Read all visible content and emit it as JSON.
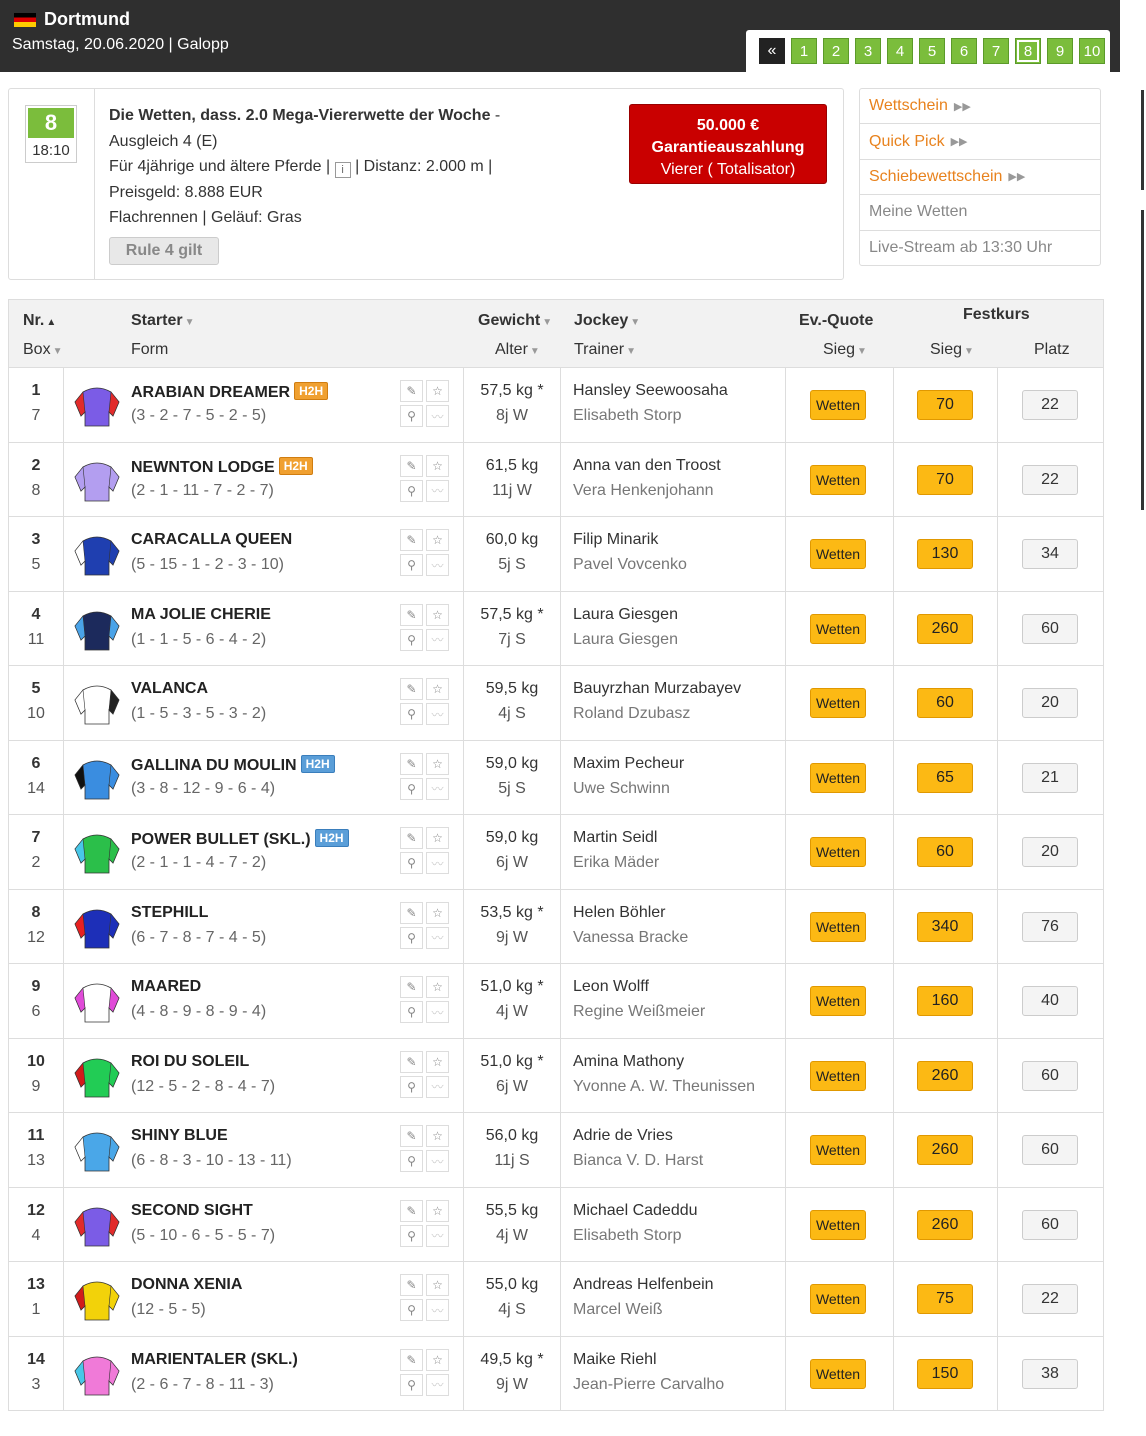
{
  "header": {
    "venue": "Dortmund",
    "subtitle": "Samstag, 20.06.2020  |  Galopp"
  },
  "racenav": {
    "back": "«",
    "races": [
      "1",
      "2",
      "3",
      "4",
      "5",
      "6",
      "7",
      "8",
      "9",
      "10"
    ],
    "active": "8"
  },
  "race": {
    "number": "8",
    "time": "18:10",
    "title": "Die Wetten, dass. 2.0 Mega-Viererwette der Woche",
    "title_suffix": " -",
    "line2": "Ausgleich 4 (E)",
    "line3a": "Für 4jährige und ältere Pferde  |  ",
    "info_icon": "i",
    "line3b": "  |  Distanz: 2.000 m  |",
    "line4": "Preisgeld: 8.888 EUR",
    "line5": "Flachrennen  |  Geläuf: Gras",
    "rule": "Rule 4 gilt",
    "garantie_amount": "50.000 €",
    "garantie_label": "Garantieauszahlung",
    "garantie_sub": "Vierer ( Totalisator)"
  },
  "links": {
    "wettschein": "Wettschein",
    "quickpick": "Quick Pick",
    "schiebe": "Schiebewettschein",
    "meine": "Meine Wetten",
    "live": "Live-Stream ab 13:30 Uhr",
    "arrows": "▶▶"
  },
  "table_head": {
    "nr": "Nr.",
    "box": "Box",
    "starter": "Starter",
    "form": "Form",
    "gewicht": "Gewicht",
    "alter": "Alter",
    "jockey": "Jockey",
    "trainer": "Trainer",
    "evquote": "Ev.-Quote",
    "evsieg": "Sieg",
    "festkurs": "Festkurs",
    "fksieg": "Sieg",
    "fkplatz": "Platz",
    "sort_up": "▲",
    "sort_down": "▼"
  },
  "bet_label": "Wetten",
  "h2h_label": "H2H",
  "colors": {
    "accent": "#e8821d",
    "green": "#7bbd3c",
    "gold": "#fcb914",
    "red": "#c90000"
  },
  "runners": [
    {
      "nr": "1",
      "box": "7",
      "name": "ARABIAN DREAMER",
      "h2h": "orange",
      "form": "(3 - 2 - 7 - 5 - 2 - 5)",
      "gewicht": "57,5 kg *",
      "alter": "8j W",
      "jockey": "Hansley Seewoosaha",
      "trainer": "Elisabeth Storp",
      "sieg": "70",
      "platz": "22",
      "silk": [
        "#7b5ce6",
        "#e22b2b",
        "#e22b2b"
      ]
    },
    {
      "nr": "2",
      "box": "8",
      "name": "NEWNTON LODGE",
      "h2h": "orange",
      "form": "(2 - 1 - 11 - 7 - 2 - 7)",
      "gewicht": "61,5 kg",
      "alter": "11j W",
      "jockey": "Anna van den Troost",
      "trainer": "Vera Henkenjohann",
      "sieg": "70",
      "platz": "22",
      "silk": [
        "#b39ef0",
        "#b39ef0",
        "#b39ef0"
      ]
    },
    {
      "nr": "3",
      "box": "5",
      "name": "CARACALLA QUEEN",
      "h2h": "",
      "form": "(5 - 15 - 1 - 2 - 3 - 10)",
      "gewicht": "60,0 kg",
      "alter": "5j S",
      "jockey": "Filip Minarik",
      "trainer": "Pavel Vovcenko",
      "sieg": "130",
      "platz": "34",
      "silk": [
        "#1f3fb0",
        "#ffffff",
        "#1f3fb0"
      ]
    },
    {
      "nr": "4",
      "box": "11",
      "name": "MA JOLIE CHERIE",
      "h2h": "",
      "form": "(1 - 1 - 5 - 6 - 4 - 2)",
      "gewicht": "57,5 kg *",
      "alter": "7j S",
      "jockey": "Laura Giesgen",
      "trainer": "Laura Giesgen",
      "sieg": "260",
      "platz": "60",
      "silk": [
        "#1c2a5c",
        "#4aa3e8",
        "#4aa3e8"
      ]
    },
    {
      "nr": "5",
      "box": "10",
      "name": "VALANCA",
      "h2h": "",
      "form": "(1 - 5 - 3 - 5 - 3 - 2)",
      "gewicht": "59,5 kg",
      "alter": "4j S",
      "jockey": "Bauyrzhan Murzabayev",
      "trainer": "Roland Dzubasz",
      "sieg": "60",
      "platz": "20",
      "silk": [
        "#ffffff",
        "#ffffff",
        "#222222"
      ]
    },
    {
      "nr": "6",
      "box": "14",
      "name": "GALLINA DU MOULIN",
      "h2h": "blue",
      "form": "(3 - 8 - 12 - 9 - 6 - 4)",
      "gewicht": "59,0 kg",
      "alter": "5j S",
      "jockey": "Maxim Pecheur",
      "trainer": "Uwe Schwinn",
      "sieg": "65",
      "platz": "21",
      "silk": [
        "#3a8de0",
        "#111111",
        "#3a8de0"
      ]
    },
    {
      "nr": "7",
      "box": "2",
      "name": "POWER BULLET (SKL.)",
      "h2h": "blue",
      "form": "(2 - 1 - 1 - 4 - 7 - 2)",
      "gewicht": "59,0 kg",
      "alter": "6j W",
      "jockey": "Martin Seidl",
      "trainer": "Erika Mäder",
      "sieg": "60",
      "platz": "20",
      "silk": [
        "#2bbf4a",
        "#48c7e8",
        "#2bbf4a"
      ]
    },
    {
      "nr": "8",
      "box": "12",
      "name": "STEPHILL",
      "h2h": "",
      "form": "(6 - 7 - 8 - 7 - 4 - 5)",
      "gewicht": "53,5 kg *",
      "alter": "9j W",
      "jockey": "Helen Böhler",
      "trainer": "Vanessa Bracke",
      "sieg": "340",
      "platz": "76",
      "silk": [
        "#1d2fb8",
        "#e82020",
        "#1d2fb8"
      ]
    },
    {
      "nr": "9",
      "box": "6",
      "name": "MAARED",
      "h2h": "",
      "form": "(4 - 8 - 9 - 8 - 9 - 4)",
      "gewicht": "51,0 kg *",
      "alter": "4j W",
      "jockey": "Leon Wolff",
      "trainer": "Regine Weißmeier",
      "sieg": "160",
      "platz": "40",
      "silk": [
        "#ffffff",
        "#e04ad8",
        "#e04ad8"
      ]
    },
    {
      "nr": "10",
      "box": "9",
      "name": "ROI DU SOLEIL",
      "h2h": "",
      "form": "(12 - 5 - 2 - 8 - 4 - 7)",
      "gewicht": "51,0 kg *",
      "alter": "6j W",
      "jockey": "Amina Mathony",
      "trainer": "Yvonne A. W. Theunissen",
      "sieg": "260",
      "platz": "60",
      "silk": [
        "#22cc55",
        "#d21b1b",
        "#22cc55"
      ]
    },
    {
      "nr": "11",
      "box": "13",
      "name": "SHINY BLUE",
      "h2h": "",
      "form": "(6 - 8 - 3 - 10 - 13 - 11)",
      "gewicht": "56,0 kg",
      "alter": "11j S",
      "jockey": "Adrie de Vries",
      "trainer": "Bianca V. D. Harst",
      "sieg": "260",
      "platz": "60",
      "silk": [
        "#4aa7e8",
        "#ffffff",
        "#4aa7e8"
      ]
    },
    {
      "nr": "12",
      "box": "4",
      "name": "SECOND SIGHT",
      "h2h": "",
      "form": "(5 - 10 - 6 - 5 - 5 - 7)",
      "gewicht": "55,5 kg",
      "alter": "4j W",
      "jockey": "Michael Cadeddu",
      "trainer": "Elisabeth Storp",
      "sieg": "260",
      "platz": "60",
      "silk": [
        "#7b5ce6",
        "#e22b2b",
        "#e22b2b"
      ]
    },
    {
      "nr": "13",
      "box": "1",
      "name": "DONNA XENIA",
      "h2h": "",
      "form": "(12 - 5 - 5)",
      "gewicht": "55,0 kg",
      "alter": "4j S",
      "jockey": "Andreas Helfenbein",
      "trainer": "Marcel Weiß",
      "sieg": "75",
      "platz": "22",
      "silk": [
        "#f2d20a",
        "#d11b1b",
        "#f2d20a"
      ]
    },
    {
      "nr": "14",
      "box": "3",
      "name": "MARIENTALER (SKL.)",
      "h2h": "",
      "form": "(2 - 6 - 7 - 8 - 11 - 3)",
      "gewicht": "49,5 kg *",
      "alter": "9j W",
      "jockey": "Maike Riehl",
      "trainer": "Jean-Pierre Carvalho",
      "sieg": "150",
      "platz": "38",
      "silk": [
        "#f07ad8",
        "#48c7e8",
        "#f07ad8"
      ]
    }
  ]
}
